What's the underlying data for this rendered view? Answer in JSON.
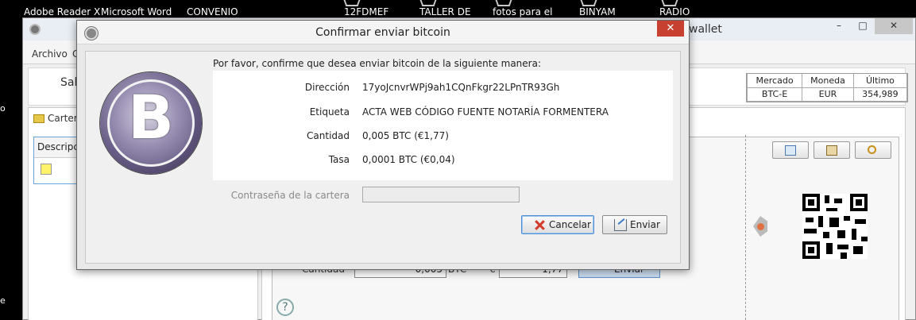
{
  "desktop": {
    "icons": [
      "Adobe Reader X",
      "Microsoft Word",
      "CONVENIO",
      "12FDMEF",
      "TALLER DE",
      "fotos para el",
      "BINYAM",
      "RADIO"
    ],
    "side_letters": [
      "o",
      "e"
    ]
  },
  "app": {
    "title": "wallet",
    "menu": [
      "Archivo",
      "C"
    ],
    "toolbar_text": "Sal",
    "window_buttons": [
      "–",
      "□",
      "✕"
    ],
    "ticker": {
      "headers": [
        "Mercado",
        "Moneda",
        "Último"
      ],
      "values": [
        "BTC-E",
        "EUR",
        "354,989"
      ]
    },
    "left_tab": "Carter",
    "list_header": "Descripci",
    "amount_label": "Cantidad",
    "amount_value": "0,005",
    "amount_unit": "BTC",
    "fiat_symbol": "€",
    "fiat_value": "1,77",
    "send_label": "Enviar",
    "help": "?"
  },
  "dialog": {
    "title": "Confirmar enviar bitcoin",
    "close": "✕",
    "logo_symbol": "B",
    "intro": "Por favor, confirme que desea enviar bitcoin de la siguiente manera:",
    "rows": [
      {
        "label": "Dirección",
        "value": "17yoJcnvrWPj9ah1CQnFkgr22LPnTR93Gh"
      },
      {
        "label": "Etiqueta",
        "value": "ACTA WEB CÓDIGO FUENTE NOTARÍA FORMENTERA"
      },
      {
        "label": "Cantidad",
        "value": "0,005 BTC  (€1,77)"
      },
      {
        "label": "Tasa",
        "value": "0,0001 BTC  (€0,04)"
      }
    ],
    "password_label": "Contraseña de la cartera",
    "password_value": "",
    "cancel_label": "Cancelar",
    "send_label": "Enviar"
  }
}
